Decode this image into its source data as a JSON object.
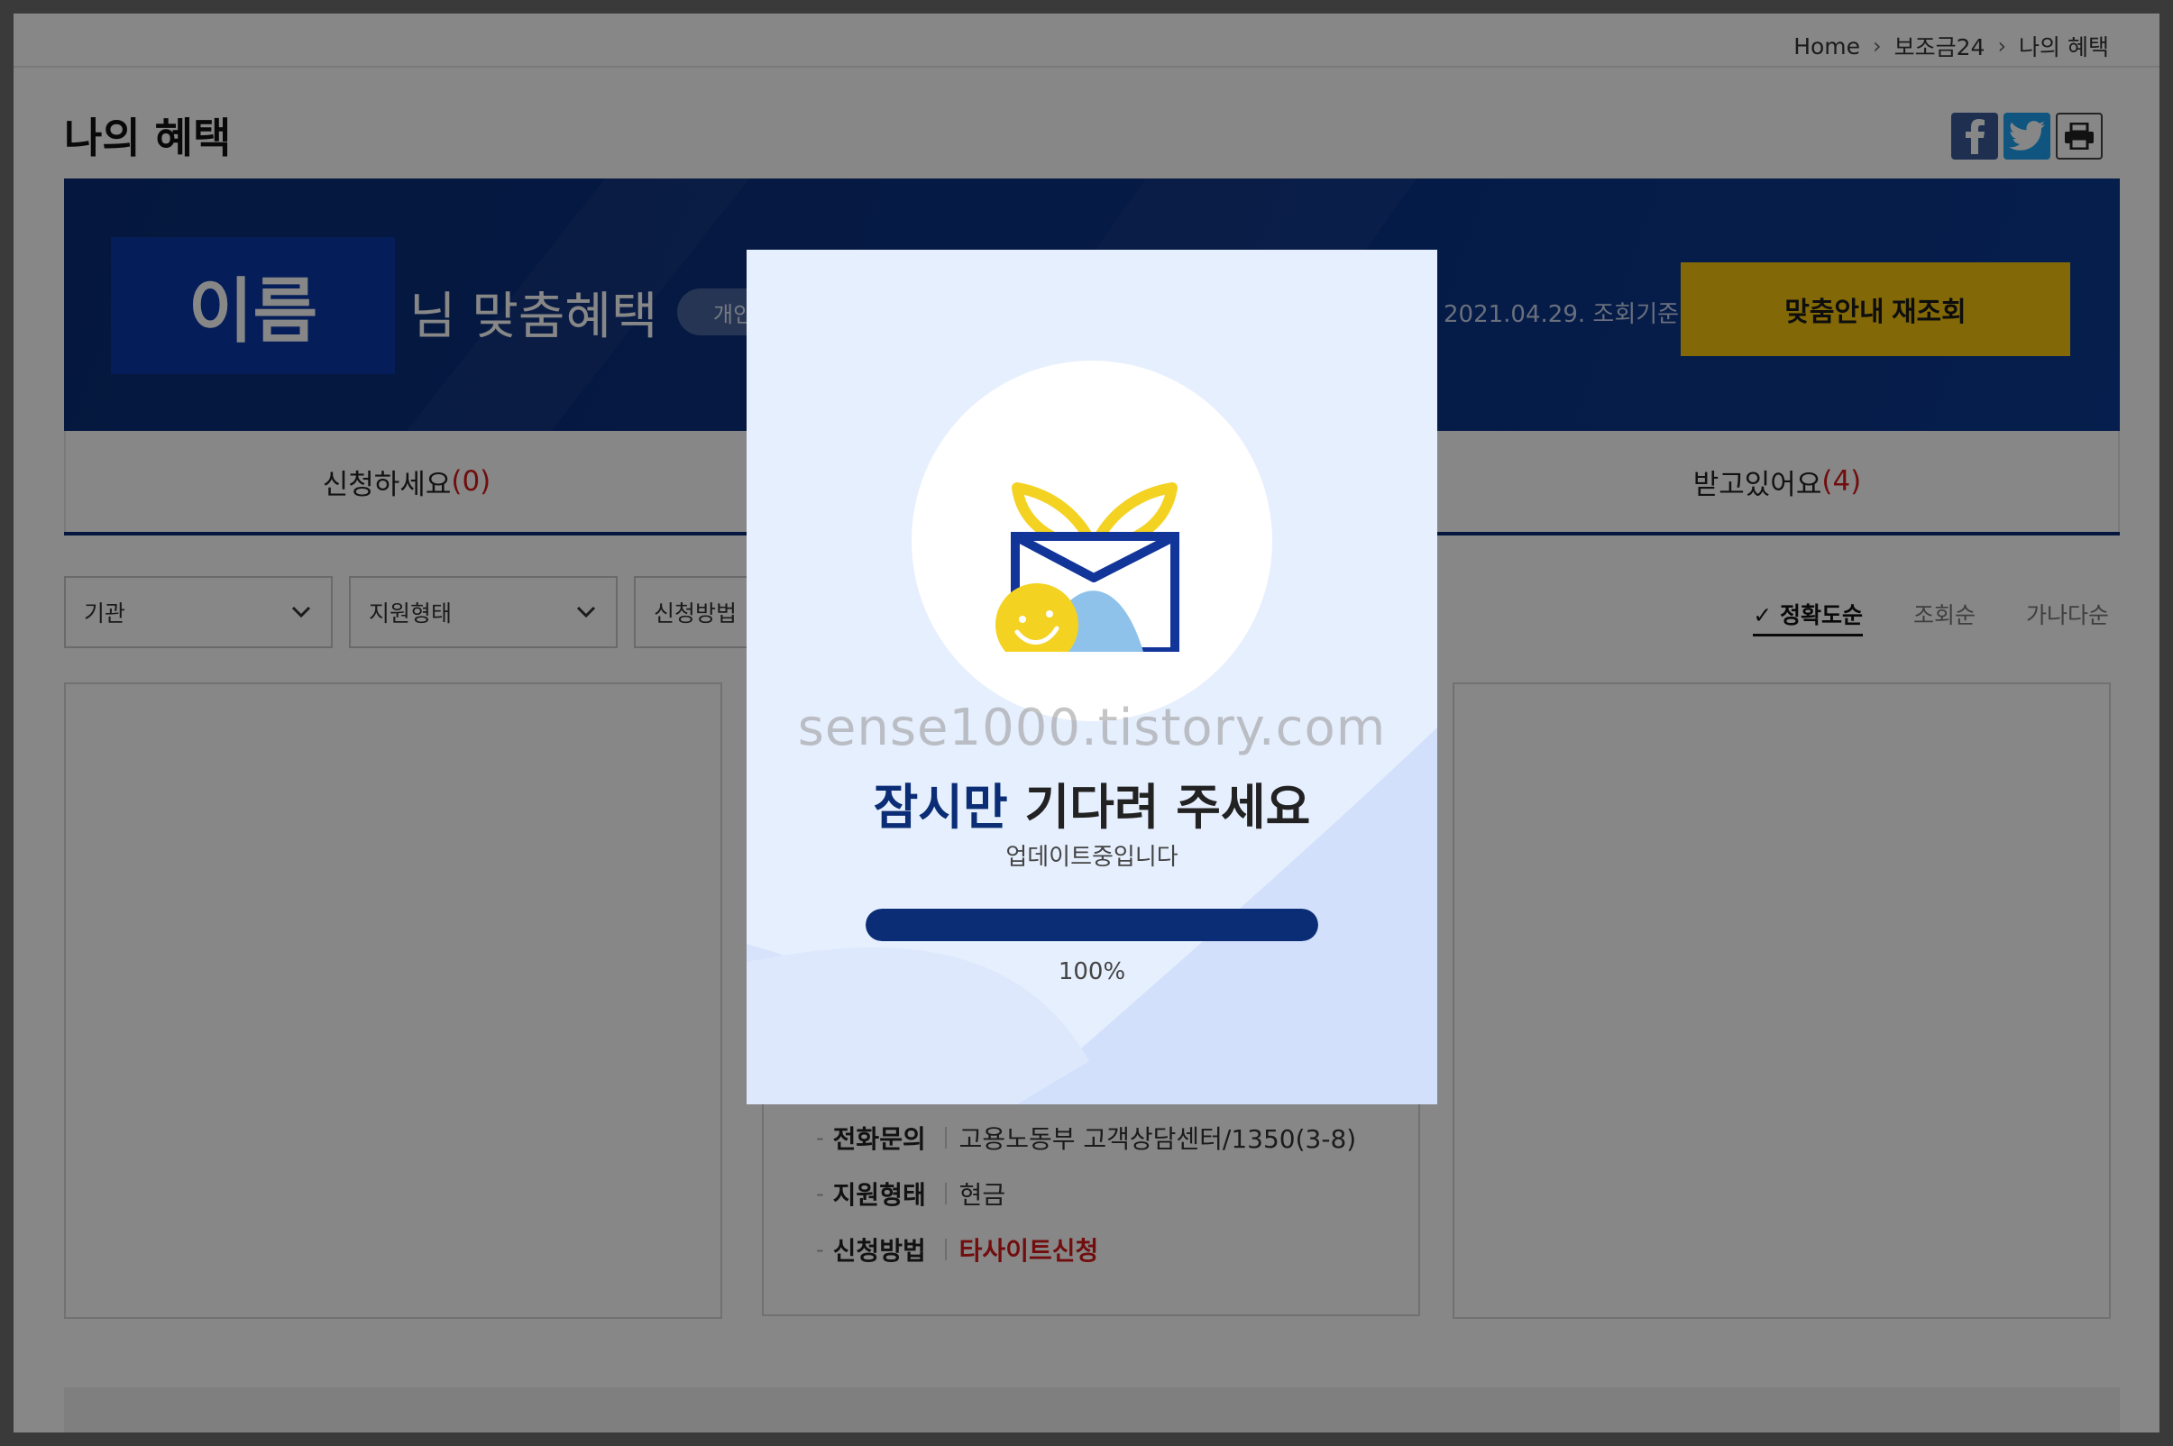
{
  "breadcrumb": {
    "home": "Home",
    "level1": "보조금24",
    "level2": "나의 혜택"
  },
  "page": {
    "title": "나의 혜택"
  },
  "share": {
    "facebook_icon": "facebook-icon",
    "twitter_icon": "twitter-icon",
    "print_icon": "printer-icon"
  },
  "banner": {
    "name": "이름",
    "suffix": "님 맞춤혜택",
    "pill": "개인",
    "date": "2021.04.29. 조회기준",
    "requery_label": "맞춤안내 재조회"
  },
  "tabs": [
    {
      "label": "신청하세요",
      "count": "(0)"
    },
    {
      "label": "받고있어요",
      "count": "(4)"
    }
  ],
  "filters": [
    "기관",
    "지원형태",
    "신청방법"
  ],
  "sorts": [
    "정확도순",
    "조회순",
    "가나다순"
  ],
  "card": {
    "rows": [
      {
        "label": "전화문의",
        "value": "고용노동부 고객상담센터/1350(3-8)"
      },
      {
        "label": "지원형태",
        "value": "현금"
      },
      {
        "label": "신청방법",
        "value": "타사이트신청"
      }
    ]
  },
  "modal": {
    "watermark": "sense1000.tistory.com",
    "title_highlight": "잠시만",
    "title_rest": " 기다려 주세요",
    "subtitle": "업데이트중입니다",
    "progress_value": 100,
    "progress_text": "100%"
  },
  "colors": {
    "navy": "#0a2d75",
    "yellow": "#f5c50d",
    "red": "#d7191a",
    "modal_bg": "#e6effd"
  }
}
